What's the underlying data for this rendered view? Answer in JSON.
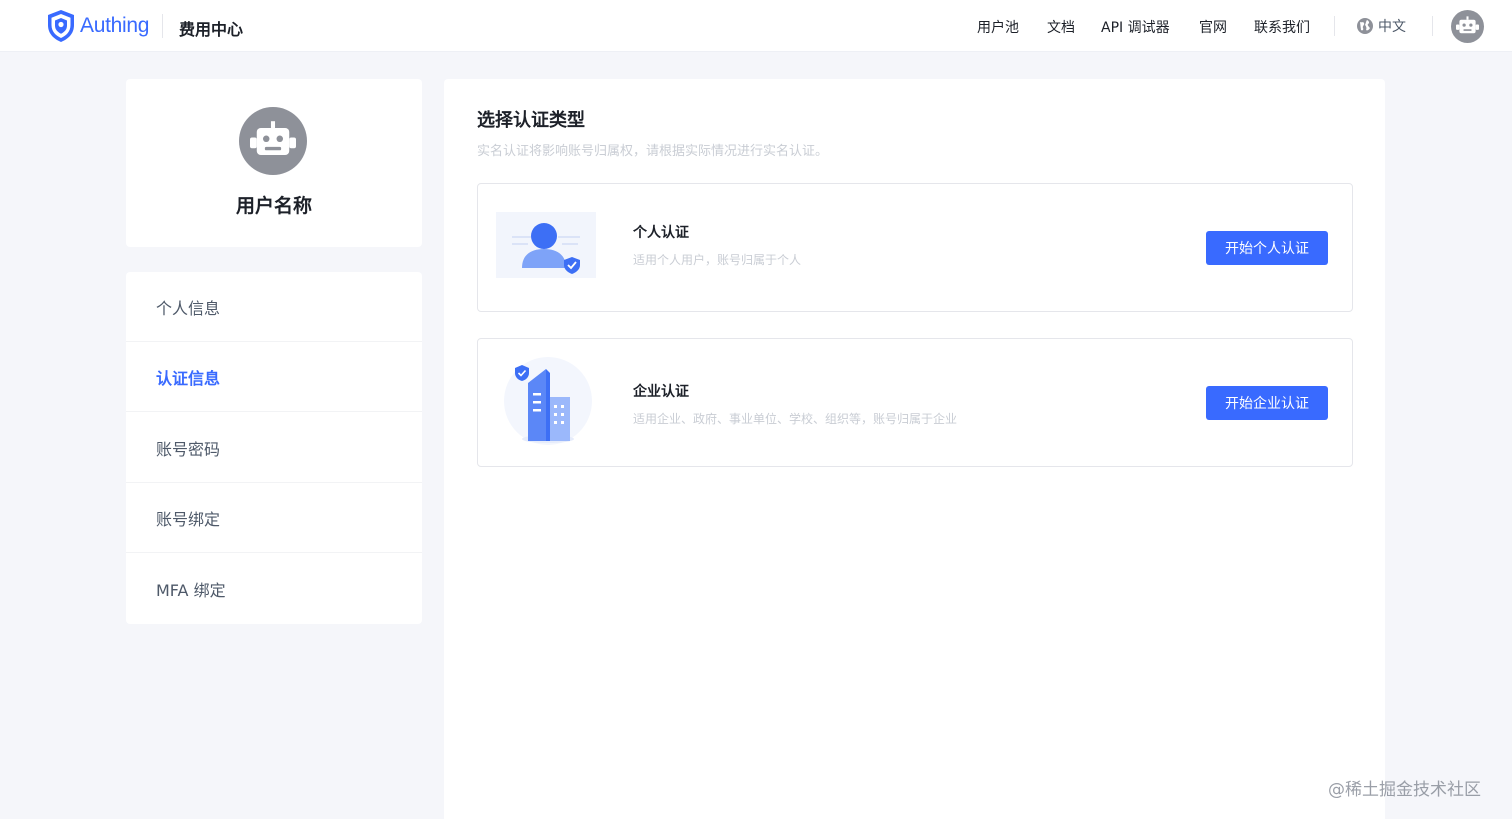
{
  "brand": {
    "name": "Authing",
    "accent": "#396aff"
  },
  "header": {
    "app_title": "费用中心",
    "nav": [
      "用户池",
      "文档",
      "API 调试器",
      "官网",
      "联系我们"
    ],
    "language": "中文",
    "language_icon": "globe-icon",
    "avatar_icon": "robot-avatar-icon"
  },
  "profile": {
    "name": "用户名称",
    "avatar_icon": "robot-avatar-icon"
  },
  "sidebar": {
    "items": [
      {
        "label": "个人信息",
        "active": false
      },
      {
        "label": "认证信息",
        "active": true
      },
      {
        "label": "账号密码",
        "active": false
      },
      {
        "label": "账号绑定",
        "active": false
      },
      {
        "label": "MFA 绑定",
        "active": false
      }
    ]
  },
  "main": {
    "title": "选择认证类型",
    "description": "实名认证将影响账号归属权，请根据实际情况进行实名认证。",
    "options": [
      {
        "title": "个人认证",
        "description": "适用个人用户，账号归属于个人",
        "button": "开始个人认证",
        "icon": "personal-verify-illustration"
      },
      {
        "title": "企业认证",
        "description": "适用企业、政府、事业单位、学校、组织等，账号归属于企业",
        "button": "开始企业认证",
        "icon": "enterprise-verify-illustration"
      }
    ]
  },
  "watermark": "@稀土掘金技术社区"
}
